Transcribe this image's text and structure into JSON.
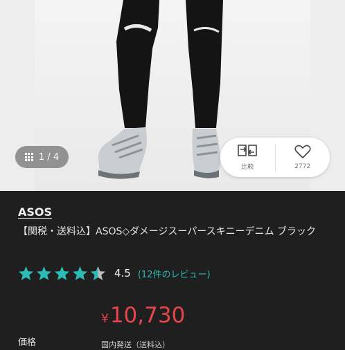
{
  "gallery": {
    "counter": "1 / 4"
  },
  "actions": {
    "compare_label": "比較",
    "favorite_count": "2772"
  },
  "product": {
    "brand": "ASOS",
    "title": "【関税・送料込】ASOS◇ダメージスーパースキニーデニム ブラック",
    "rating": 4.5,
    "rating_text": "4.5",
    "review_link": "(12件のレビュー)",
    "price_currency": "¥",
    "price_value": "10,730",
    "price_label": "価格",
    "shipping_text": "国内発送（送料込）"
  },
  "colors": {
    "accent_teal": "#2bbcb6",
    "price_red": "#e8454e",
    "star_teal": "#2bbcb6",
    "star_empty": "#bdbdbd"
  }
}
